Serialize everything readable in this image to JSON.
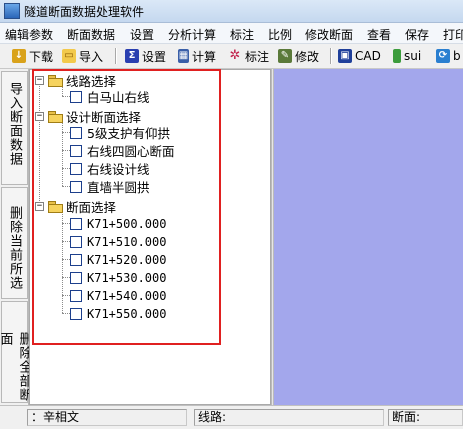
{
  "window": {
    "title": "隧道断面数据处理软件"
  },
  "menu": [
    "编辑参数",
    "断面数据",
    "设置",
    "分析计算",
    "标注",
    "比例",
    "修改断面",
    "查看",
    "保存",
    "打印"
  ],
  "toolbar": {
    "download": "下载",
    "import": "导入",
    "settings": "设置",
    "calculate": "计算",
    "annotate": "标注",
    "modify": "修改",
    "cad": "CAD",
    "sui": "sui",
    "more": "b"
  },
  "sidebar": {
    "import_section_data": "导入断面数据",
    "delete_current_selection": "删除当前所选",
    "delete_all_sections": "删除全部断面"
  },
  "tree": {
    "route_group": "线路选择",
    "route_items": [
      "白马山右线"
    ],
    "design_group": "设计断面选择",
    "design_items": [
      "5级支护有仰拱",
      "右线四圆心断面",
      "右线设计线",
      "直墙半圆拱"
    ],
    "section_group": "断面选择",
    "section_items": [
      "K71+500.000",
      "K71+510.000",
      "K71+520.000",
      "K71+530.000",
      "K71+540.000",
      "K71+550.000"
    ]
  },
  "status": {
    "user": "：辛相文",
    "route_label": "线路:",
    "section_label": "断面:"
  },
  "colors": {
    "draw_area": "#a3a7ec",
    "highlight_box": "#e02020"
  }
}
